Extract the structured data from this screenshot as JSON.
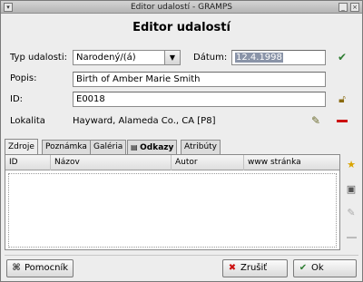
{
  "window": {
    "title": "Editor udalostí - GRAMPS"
  },
  "heading": "Editor udalostí",
  "form": {
    "type_label": "Typ udalosti:",
    "type_value": "Narodený/(á)",
    "date_label": "Dátum:",
    "date_value": "12.4.1998",
    "description_label": "Popis:",
    "description_value": "Birth of Amber Marie Smith",
    "id_label": "ID:",
    "id_value": "E0018",
    "place_label": "Lokalita",
    "place_value": "Hayward, Alameda Co., CA [P8]"
  },
  "tabs": [
    {
      "label": "Zdroje",
      "active": true
    },
    {
      "label": "Poznámka",
      "active": false
    },
    {
      "label": "Galéria",
      "active": false
    },
    {
      "label": "Odkazy",
      "active": false
    },
    {
      "label": "Atribúty",
      "active": false
    }
  ],
  "table": {
    "columns": [
      "ID",
      "Názov",
      "Autor",
      "www stránka"
    ],
    "rows": []
  },
  "buttons": {
    "help": "Pomocník",
    "cancel": "Zrušiť",
    "ok": "Ok"
  },
  "icons": {
    "date_valid": "checkmark-icon",
    "id_lock": "padlock-icon",
    "place_edit": "edit-icon",
    "place_remove": "remove-icon",
    "add_source": "star-add-icon",
    "share_source": "share-icon",
    "edit_source": "edit-icon",
    "remove_source": "remove-icon"
  },
  "colors": {
    "accent": "#2e7d32",
    "remove": "#cc1010",
    "selection": "#8a94a8"
  }
}
